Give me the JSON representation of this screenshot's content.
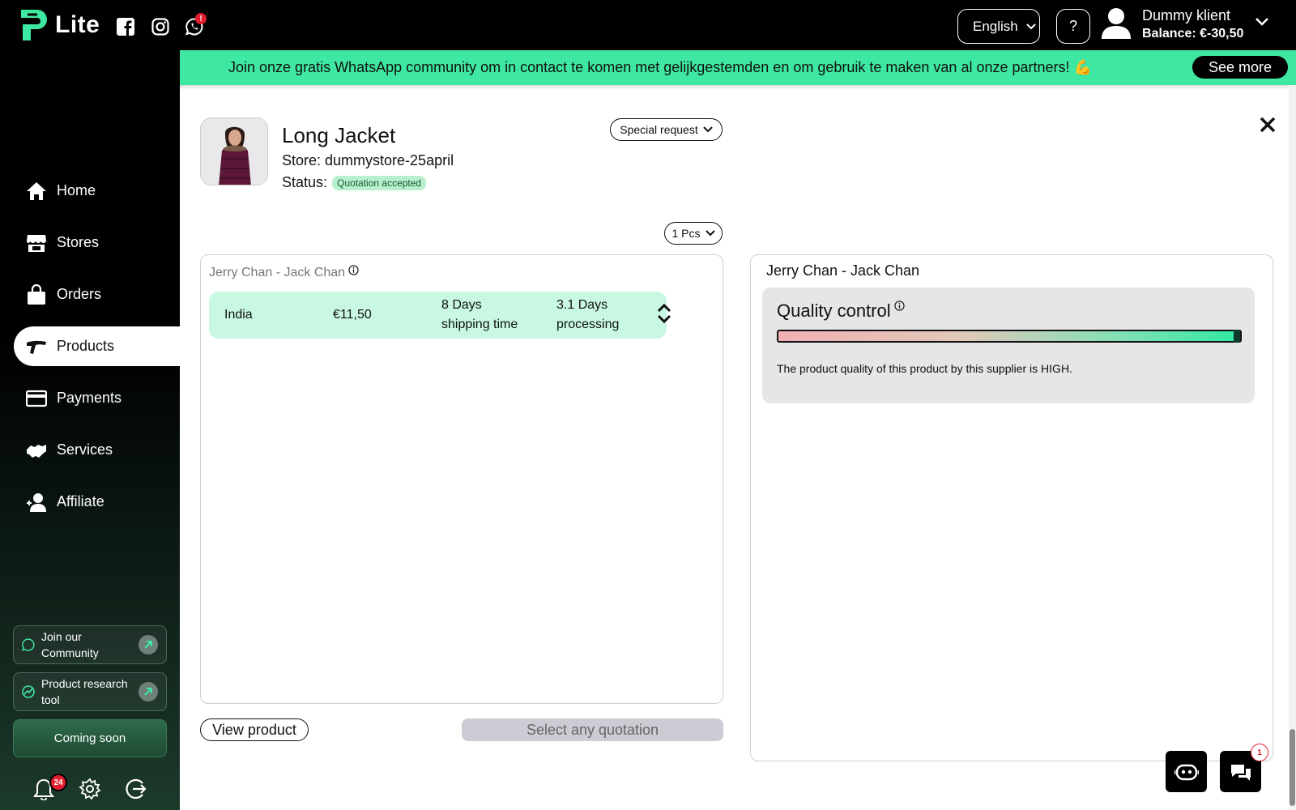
{
  "app": {
    "logo_text": "Lite"
  },
  "header": {
    "language": "English",
    "help": "?",
    "user_name": "Dummy klient",
    "user_balance": "Balance: €-30,50",
    "whatsapp_badge": "!"
  },
  "banner": {
    "text": "Join onze gratis WhatsApp community om in contact te komen met gelijkgestemden en om gebruik te maken van al onze partners! 💪",
    "button": "See more"
  },
  "sidebar": {
    "items": [
      {
        "label": "Home",
        "icon": "home-icon"
      },
      {
        "label": "Stores",
        "icon": "store-icon"
      },
      {
        "label": "Orders",
        "icon": "bag-icon"
      },
      {
        "label": "Products",
        "icon": "products-icon",
        "active": true
      },
      {
        "label": "Payments",
        "icon": "card-icon"
      },
      {
        "label": "Services",
        "icon": "handshake-icon"
      },
      {
        "label": "Affiliate",
        "icon": "add-user-icon"
      }
    ],
    "community": "Join our Community",
    "research": "Product research tool",
    "coming_soon": "Coming soon",
    "notifications_count": "24"
  },
  "product": {
    "title": "Long Jacket",
    "store": "Store: dummystore-25april",
    "status_label": "Status:",
    "status": "Quotation accepted",
    "special_request": "Special request",
    "quantity": "1 Pcs"
  },
  "quotation": {
    "supplier": "Jerry Chan - Jack Chan",
    "country": "India",
    "price": "€11,50",
    "shipping_1": "8 Days",
    "shipping_2": "shipping time",
    "processing_1": "3.1 Days",
    "processing_2": "processing"
  },
  "quality": {
    "supplier": "Jerry Chan - Jack Chan",
    "title": "Quality control",
    "level": 1.0,
    "text": "The product quality of this product by this supplier is HIGH."
  },
  "actions": {
    "view_product": "View product",
    "select_quotation": "Select any quotation"
  },
  "chat": {
    "badge": "1"
  },
  "colors": {
    "accent": "#3ee8a2",
    "row": "#c8f8e2",
    "status_badge": "#b8efcc"
  }
}
